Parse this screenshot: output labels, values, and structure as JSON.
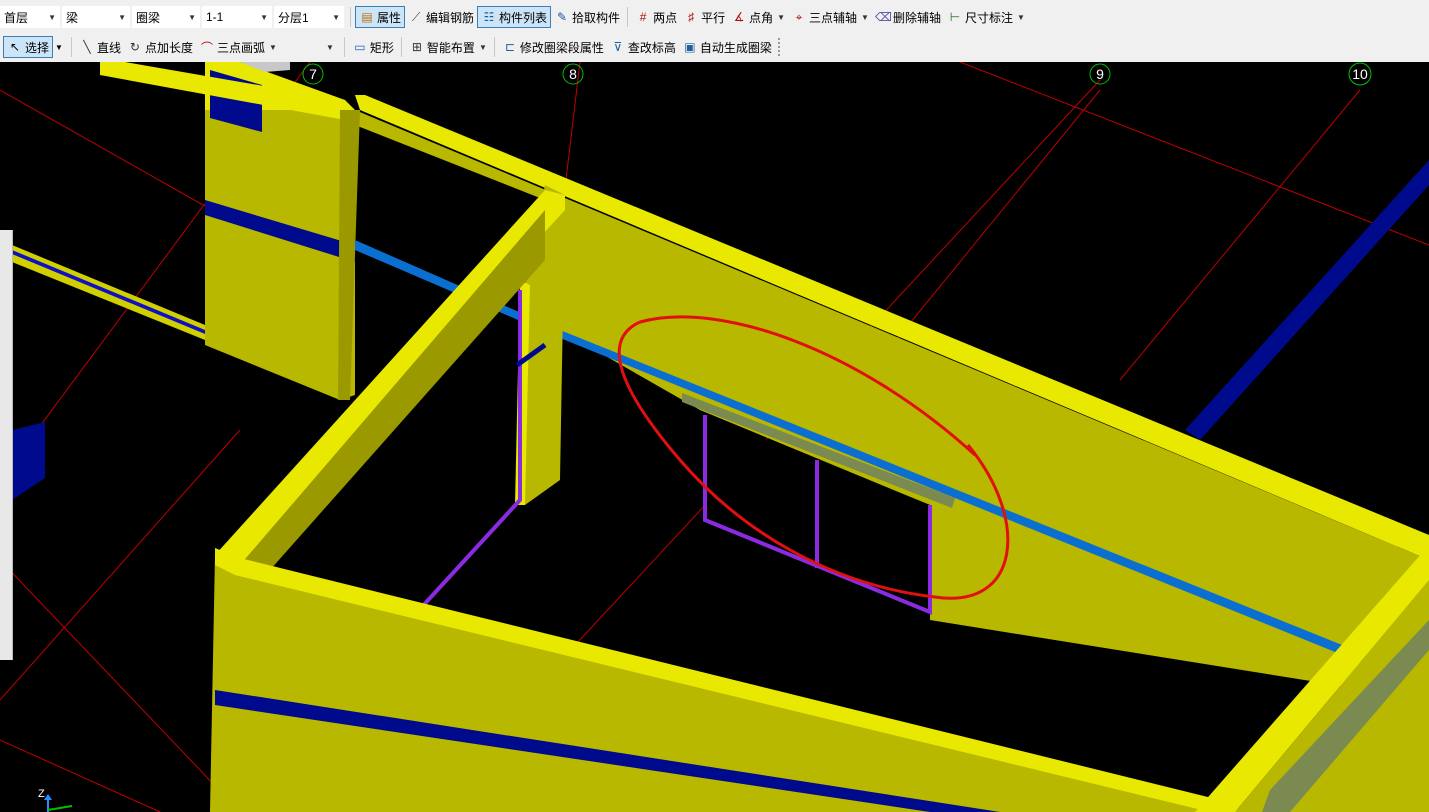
{
  "toolbar": {
    "row1": {
      "floor_select": "首层",
      "type_select": "梁",
      "subtype_select": "圈梁",
      "name_select": "1-1",
      "layer_select": "分层1",
      "buttons": {
        "properties": "属性",
        "edit_rebar": "编辑钢筋",
        "component_list": "构件列表",
        "pick_component": "拾取构件",
        "two_points": "两点",
        "parallel": "平行",
        "point_angle": "点角",
        "three_point_axis": "三点辅轴",
        "delete_axis": "删除辅轴",
        "dimension": "尺寸标注"
      }
    },
    "row2": {
      "select": "选择",
      "line": "直线",
      "point_length": "点加长度",
      "three_point_arc": "三点画弧",
      "rectangle": "矩形",
      "smart_layout": "智能布置",
      "modify_segment": "修改圈梁段属性",
      "check_elevation": "查改标高",
      "auto_generate": "自动生成圈梁"
    }
  },
  "viewport": {
    "axis_labels": [
      "7",
      "8",
      "9",
      "10"
    ],
    "coord_axis_label": "Z",
    "colors": {
      "wall_face": "#b8b800",
      "wall_top": "#e8e800",
      "ring_beam": "#0a6fd0",
      "dark_beam": "#000a8c",
      "opening": "#8a2be2",
      "grid_line": "#c00000",
      "annotation": "#e01010"
    }
  }
}
